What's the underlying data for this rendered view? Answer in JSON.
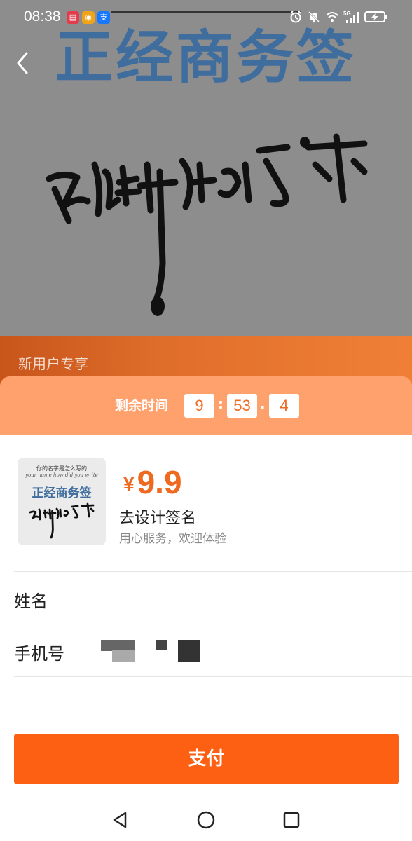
{
  "status_bar": {
    "time": "08:38",
    "app_icons": [
      {
        "icon": "book-app-icon",
        "color": "#e23d4b",
        "glyph": "▤"
      },
      {
        "icon": "weibo-app-icon",
        "color": "#f2a418",
        "glyph": "◉"
      },
      {
        "icon": "alipay-app-icon",
        "color": "#1677ff",
        "glyph": "支"
      }
    ],
    "network_label": "5G"
  },
  "hero": {
    "title": "正经商务签",
    "section_label": "新用户专享"
  },
  "timer": {
    "label": "剩余时间",
    "minutes": "9",
    "seconds": "53",
    "tenths": "4",
    "sep1": ":",
    "sep2": "."
  },
  "product": {
    "thumb_top": "你的名字是怎么写的",
    "thumb_sub": "your name how did you write",
    "thumb_title": "正经商务签",
    "currency": "¥",
    "price": "9.9",
    "name": "去设计签名",
    "description": "用心服务，欢迎体验"
  },
  "form": {
    "name_label": "姓名",
    "name_value": "",
    "phone_label": "手机号",
    "phone_value": ""
  },
  "pay_button": "支付",
  "colors": {
    "accent": "#fd5f13",
    "timer_bar": "#ffa16d",
    "price": "#ef6a21",
    "hero_title": "#3f6e9e"
  }
}
